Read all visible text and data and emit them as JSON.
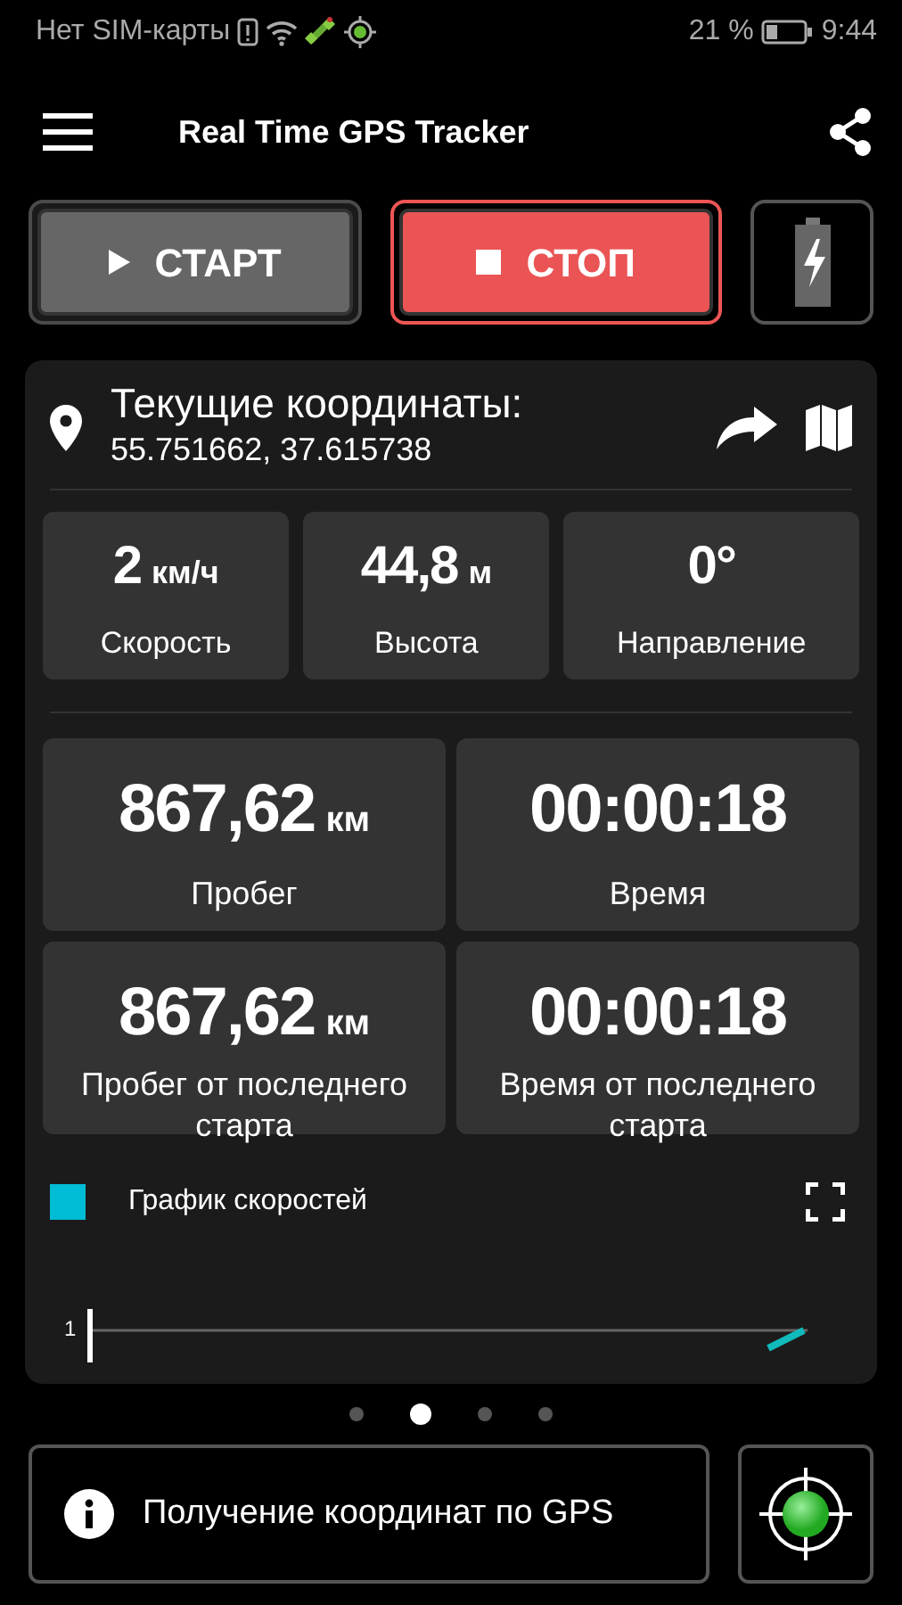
{
  "status_bar": {
    "carrier": "Нет SIM-карты",
    "battery_percent": "21 %",
    "time": "9:44"
  },
  "app_bar": {
    "title": "Real Time GPS Tracker"
  },
  "controls": [
    {
      "kind": "start",
      "label": "СТАРТ",
      "selected": false
    },
    {
      "kind": "stop",
      "label": "СТОП",
      "selected": true
    },
    {
      "kind": "battery"
    }
  ],
  "coordinates": {
    "title": "Текущие координаты:",
    "value": "55.751662, 37.615738"
  },
  "small_stats": [
    {
      "value": "2",
      "unit": "км/ч",
      "label": "Скорость"
    },
    {
      "value": "44,8",
      "unit": "м",
      "label": "Высота"
    },
    {
      "value": "0°",
      "label": "Направление"
    }
  ],
  "big_stats": [
    {
      "value": "867,62",
      "unit": "км",
      "label": "Пробег"
    },
    {
      "value": "00:00:18",
      "label": "Время"
    },
    {
      "value": "867,62",
      "unit": "км",
      "label": "Пробег от последнего старта"
    },
    {
      "value": "00:00:18",
      "label": "Время от последнего старта"
    }
  ],
  "speed_chart": {
    "legend": "График скоростей",
    "color": "#00bcd4",
    "y_tick_label": "1"
  },
  "page_dots": [
    {
      "selected": false
    },
    {
      "selected": true
    },
    {
      "selected": false
    },
    {
      "selected": false
    }
  ],
  "gps_status": {
    "message": "Получение координат по GPS"
  }
}
